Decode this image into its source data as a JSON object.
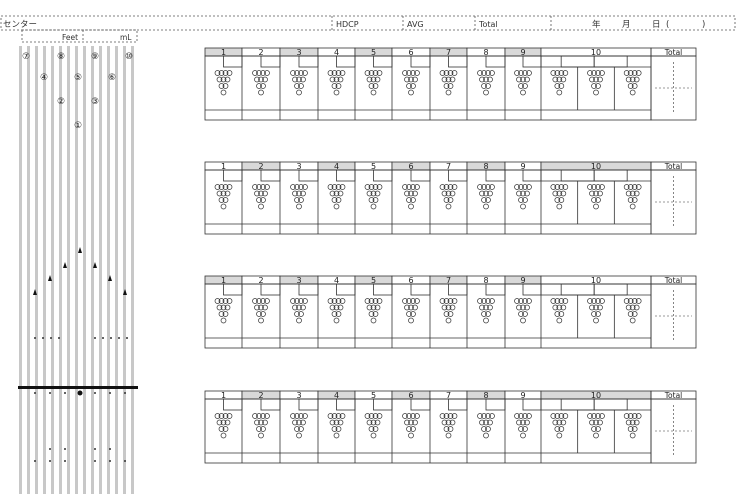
{
  "header": {
    "center_label": "センター",
    "hdcp_label": "HDCP",
    "avg_label": "AVG",
    "total_label": "Total",
    "year_label": "年",
    "month_label": "月",
    "day_label": "日",
    "paren_open": "(",
    "paren_close": ")",
    "feet_label": "Feet",
    "ml_label": "mL"
  },
  "lane": {
    "pin_labels": [
      "⑦",
      "⑧",
      "⑨",
      "⑩",
      "④",
      "⑤",
      "⑥",
      "②",
      "③",
      "①"
    ]
  },
  "scoresheets": [
    {
      "frame_labels": [
        "1",
        "2",
        "3",
        "4",
        "5",
        "6",
        "7",
        "8",
        "9",
        "10"
      ],
      "shaded_frames": [
        1,
        3,
        5,
        7,
        9
      ],
      "total_label": "Total"
    },
    {
      "frame_labels": [
        "1",
        "2",
        "3",
        "4",
        "5",
        "6",
        "7",
        "8",
        "9",
        "10"
      ],
      "shaded_frames": [
        2,
        4,
        6,
        8,
        10
      ],
      "total_label": "Total"
    },
    {
      "frame_labels": [
        "1",
        "2",
        "3",
        "4",
        "5",
        "6",
        "7",
        "8",
        "9",
        "10"
      ],
      "shaded_frames": [
        1,
        3,
        5,
        7,
        9
      ],
      "total_label": "Total"
    },
    {
      "frame_labels": [
        "1",
        "2",
        "3",
        "4",
        "5",
        "6",
        "7",
        "8",
        "9",
        "10"
      ],
      "shaded_frames": [
        2,
        4,
        6,
        8,
        10
      ],
      "total_label": "Total"
    }
  ],
  "colors": {
    "line": "#333333",
    "shade": "#d9d9d9",
    "lane_board": "#c8c8c8"
  }
}
